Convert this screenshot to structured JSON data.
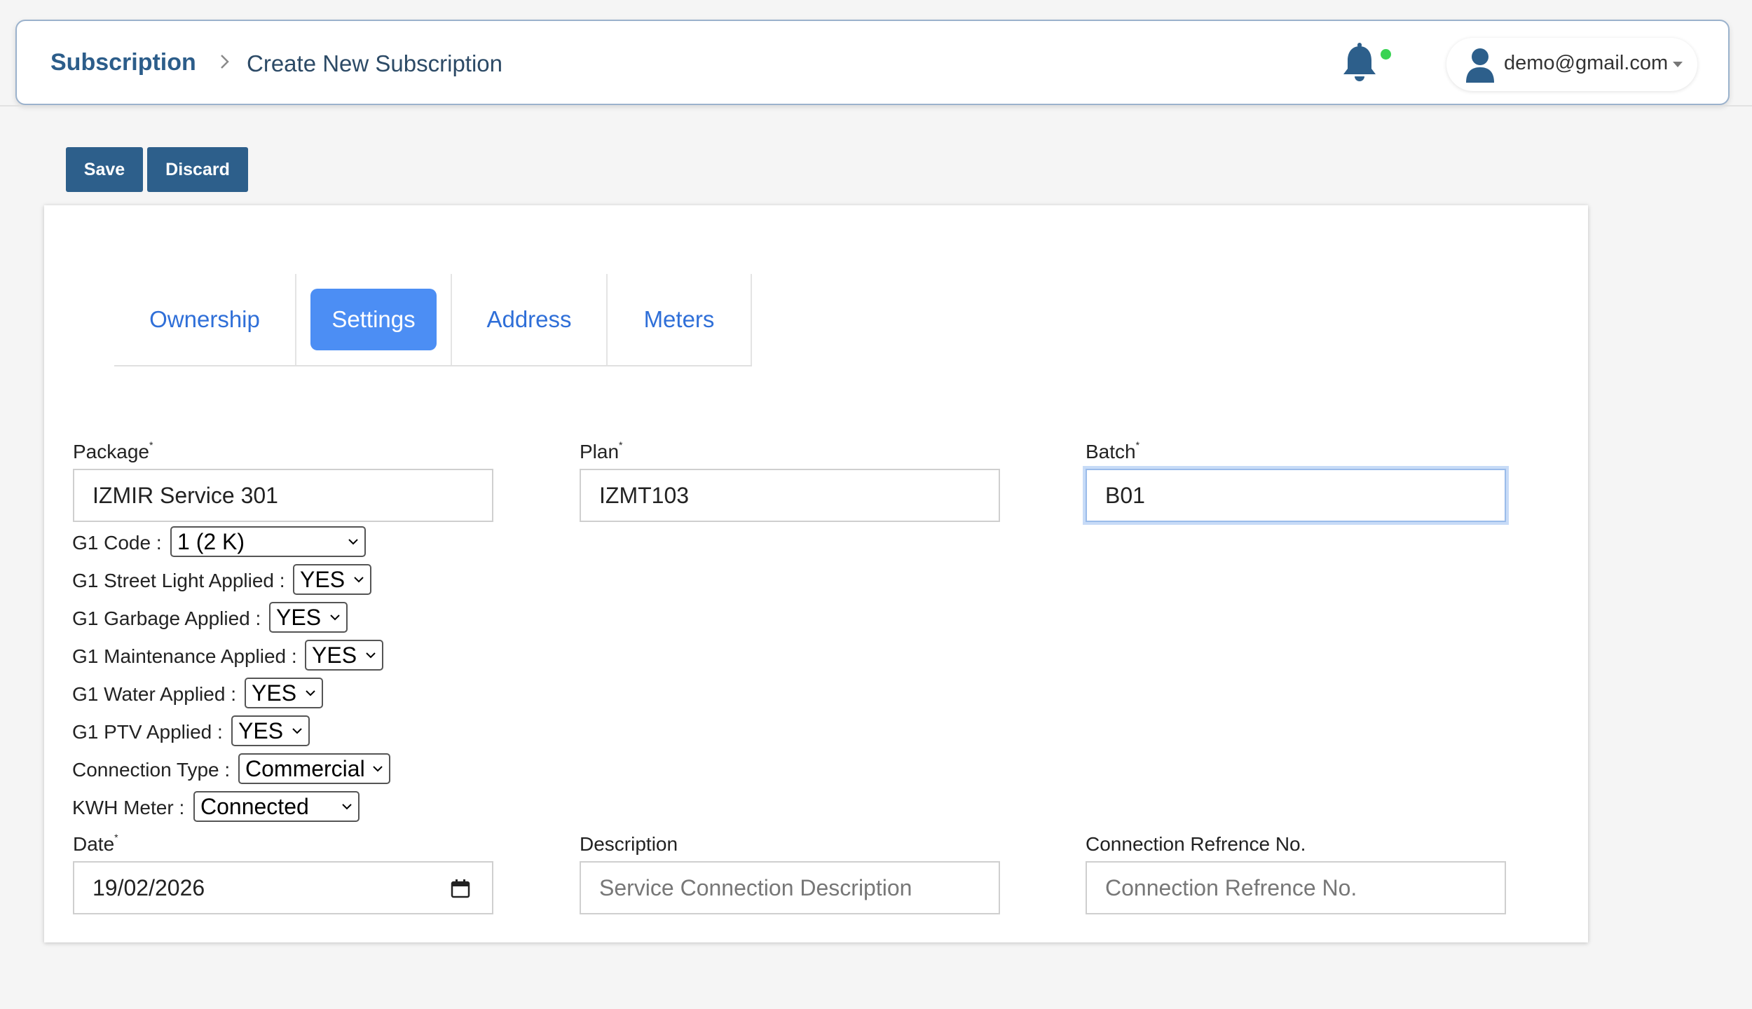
{
  "header": {
    "breadcrumb_root": "Subscription",
    "breadcrumb_current": "Create New Subscription",
    "user_email": "demo@gmail.com",
    "icons": [
      "chevron-right-icon",
      "bell-icon",
      "user-icon",
      "caret-down-icon"
    ],
    "notification_dot_color": "#39d353"
  },
  "toolbar": {
    "save_label": "Save",
    "discard_label": "Discard"
  },
  "tabs": [
    {
      "label": "Ownership",
      "active": false
    },
    {
      "label": "Settings",
      "active": true
    },
    {
      "label": "Address",
      "active": false
    },
    {
      "label": "Meters",
      "active": false
    }
  ],
  "form": {
    "package": {
      "label": "Package",
      "required": "*",
      "value": "IZMIR Service 301"
    },
    "plan": {
      "label": "Plan",
      "required": "*",
      "value": "IZMT103"
    },
    "batch": {
      "label": "Batch",
      "required": "*",
      "value": "B01"
    },
    "settings": [
      {
        "label": "G1 Code :",
        "value": "1 (2 K)"
      },
      {
        "label": "G1 Street Light Applied :",
        "value": "YES"
      },
      {
        "label": "G1 Garbage Applied :",
        "value": "YES"
      },
      {
        "label": "G1 Maintenance Applied :",
        "value": "YES"
      },
      {
        "label": "G1 Water Applied :",
        "value": "YES"
      },
      {
        "label": "G1 PTV Applied :",
        "value": "YES"
      },
      {
        "label": "Connection Type :",
        "value": "Commercial"
      },
      {
        "label": "KWH Meter :",
        "value": "Connected"
      }
    ],
    "date": {
      "label": "Date",
      "required": "*",
      "value": "19/02/2026"
    },
    "description": {
      "label": "Description",
      "placeholder": "Service Connection Description"
    },
    "connection_ref": {
      "label": "Connection Refrence No.",
      "placeholder": "Connection Refrence No."
    }
  },
  "colors": {
    "brand": "#2d5f8b",
    "tab_link": "#2f6fd8",
    "tab_active": "#4c8ef4"
  }
}
